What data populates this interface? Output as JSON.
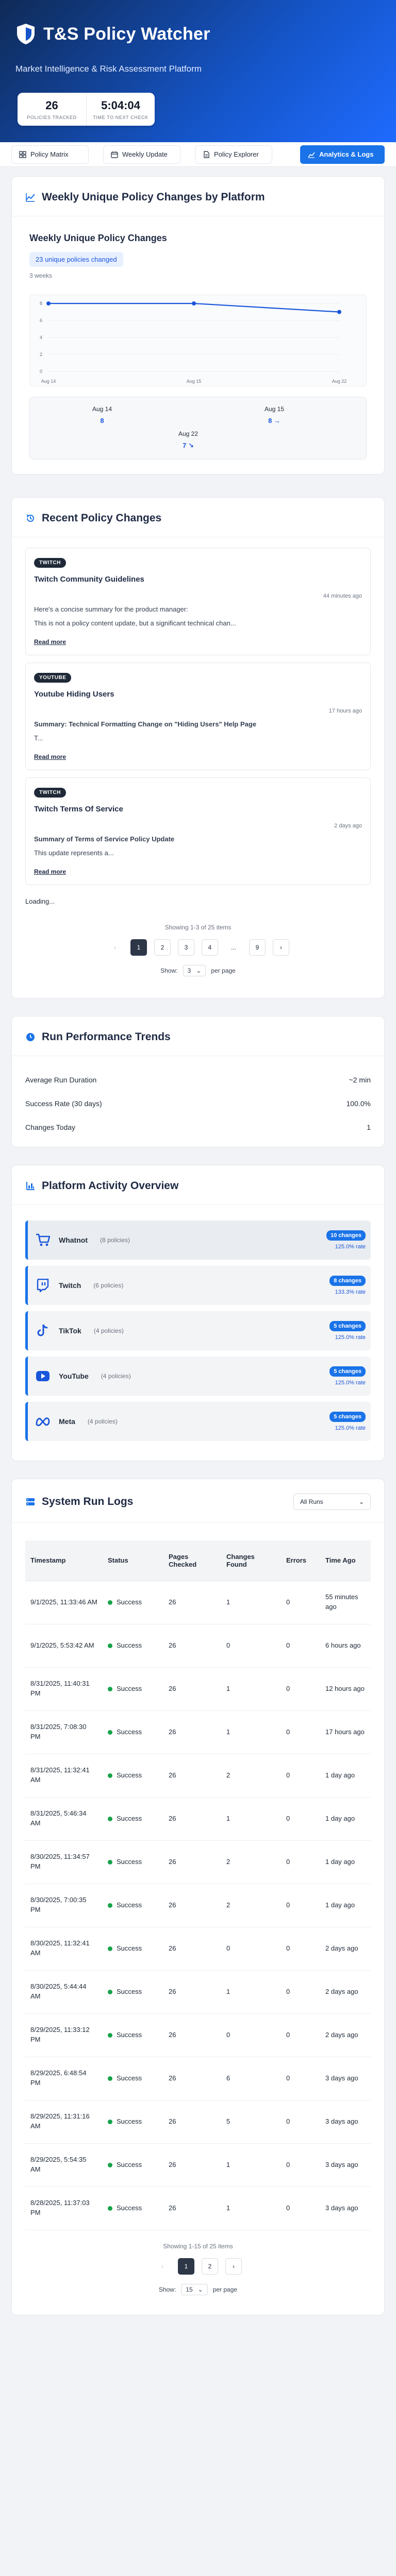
{
  "app": {
    "title": "T&S Policy Watcher",
    "subtitle": "Market Intelligence & Risk Assessment Platform",
    "stats": [
      {
        "value": "26",
        "label": "Policies Tracked"
      },
      {
        "value": "5:04:04",
        "label": "Time to next check"
      }
    ]
  },
  "nav": {
    "tabs": [
      {
        "label": "Policy Matrix",
        "icon": "grid-icon"
      },
      {
        "label": "Weekly Update",
        "icon": "calendar-icon"
      },
      {
        "label": "Policy Explorer",
        "icon": "document-icon"
      },
      {
        "label": "Analytics & Logs",
        "icon": "chart-icon",
        "active": true
      }
    ]
  },
  "weekly": {
    "card_title": "Weekly Unique Policy Changes by Platform",
    "chart_title": "Weekly Unique Policy Changes",
    "badge": "23 unique policies changed",
    "period": "3 weeks"
  },
  "chart_data": {
    "type": "line",
    "title": "Weekly Unique Policy Changes",
    "categories": [
      "Aug 14",
      "Aug 15",
      "Aug 22"
    ],
    "series": [
      {
        "values": [
          8,
          8,
          7
        ]
      }
    ],
    "ylim": [
      0,
      8
    ],
    "yticks": [
      0,
      2,
      4,
      6,
      8
    ],
    "grid": true,
    "color": "#1a56db"
  },
  "weekly_points": [
    {
      "date": "Aug 14",
      "value": "8"
    },
    {
      "date": "Aug 15",
      "value": "8 →"
    },
    {
      "date": "Aug 22",
      "value": "7 ↘"
    }
  ],
  "recent": {
    "card_title": "Recent Policy Changes",
    "items": [
      {
        "platform": "TWITCH",
        "title": "Twitch Community Guidelines",
        "time": "44 minutes ago",
        "line1": "Here's a concise summary for the product manager:",
        "line2": "This is not a policy content update, but a significant technical chan...",
        "line1_bold": false,
        "read_more": "Read more"
      },
      {
        "platform": "YOUTUBE",
        "title": "Youtube Hiding Users",
        "time": "17 hours ago",
        "line1": "Summary: Technical Formatting Change on \"Hiding Users\" Help Page",
        "line2": "T...",
        "line1_bold": true,
        "read_more": "Read more"
      },
      {
        "platform": "TWITCH",
        "title": "Twitch Terms Of Service",
        "time": "2 days ago",
        "line1": "Summary of Terms of Service Policy Update",
        "line2": "This update represents a...",
        "line1_bold": true,
        "read_more": "Read more"
      }
    ],
    "loading": "Loading...",
    "pager_info": "Showing 1-3 of 25 items",
    "pages": [
      "1",
      "2",
      "3",
      "4",
      "...",
      "9"
    ],
    "show_label": "Show:",
    "show_value": "3",
    "per_page": "per page"
  },
  "performance": {
    "card_title": "Run Performance Trends",
    "rows": [
      {
        "label": "Average Run Duration",
        "value": "~2 min"
      },
      {
        "label": "Success Rate (30 days)",
        "value": "100.0%"
      },
      {
        "label": "Changes Today",
        "value": "1"
      }
    ]
  },
  "platforms": {
    "card_title": "Platform Activity Overview",
    "items": [
      {
        "name": "Whatnot",
        "count": "(8 policies)",
        "badge": "10 changes",
        "rate": "125.0% rate",
        "icon": "cart-icon",
        "color": "#1f6bd6"
      },
      {
        "name": "Twitch",
        "count": "(6 policies)",
        "badge": "8 changes",
        "rate": "133.3% rate",
        "icon": "twitch-icon",
        "color": "#1f6bd6"
      },
      {
        "name": "TikTok",
        "count": "(4 policies)",
        "badge": "5 changes",
        "rate": "125.0% rate",
        "icon": "tiktok-icon",
        "color": "#1f6bd6"
      },
      {
        "name": "YouTube",
        "count": "(4 policies)",
        "badge": "5 changes",
        "rate": "125.0% rate",
        "icon": "youtube-icon",
        "color": "#1f6bd6"
      },
      {
        "name": "Meta",
        "count": "(4 policies)",
        "badge": "5 changes",
        "rate": "125.0% rate",
        "icon": "meta-icon",
        "color": "#1f6bd6"
      }
    ]
  },
  "logs": {
    "card_title": "System Run Logs",
    "filter": "All Runs",
    "columns": [
      "Timestamp",
      "Status",
      "Pages Checked",
      "Changes Found",
      "Errors",
      "Time Ago"
    ],
    "rows": [
      [
        "9/1/2025, 11:33:46 AM",
        "Success",
        "26",
        "1",
        "0",
        "55 minutes ago"
      ],
      [
        "9/1/2025, 5:53:42 AM",
        "Success",
        "26",
        "0",
        "0",
        "6 hours ago"
      ],
      [
        "8/31/2025, 11:40:31 PM",
        "Success",
        "26",
        "1",
        "0",
        "12 hours ago"
      ],
      [
        "8/31/2025, 7:08:30 PM",
        "Success",
        "26",
        "1",
        "0",
        "17 hours ago"
      ],
      [
        "8/31/2025, 11:32:41 AM",
        "Success",
        "26",
        "2",
        "0",
        "1 day ago"
      ],
      [
        "8/31/2025, 5:46:34 AM",
        "Success",
        "26",
        "1",
        "0",
        "1 day ago"
      ],
      [
        "8/30/2025, 11:34:57 PM",
        "Success",
        "26",
        "2",
        "0",
        "1 day ago"
      ],
      [
        "8/30/2025, 7:00:35 PM",
        "Success",
        "26",
        "2",
        "0",
        "1 day ago"
      ],
      [
        "8/30/2025, 11:32:41 AM",
        "Success",
        "26",
        "0",
        "0",
        "2 days ago"
      ],
      [
        "8/30/2025, 5:44:44 AM",
        "Success",
        "26",
        "1",
        "0",
        "2 days ago"
      ],
      [
        "8/29/2025, 11:33:12 PM",
        "Success",
        "26",
        "0",
        "0",
        "2 days ago"
      ],
      [
        "8/29/2025, 6:48:54 PM",
        "Success",
        "26",
        "6",
        "0",
        "3 days ago"
      ],
      [
        "8/29/2025, 11:31:16 AM",
        "Success",
        "26",
        "5",
        "0",
        "3 days ago"
      ],
      [
        "8/29/2025, 5:54:35 AM",
        "Success",
        "26",
        "1",
        "0",
        "3 days ago"
      ],
      [
        "8/28/2025, 11:37:03 PM",
        "Success",
        "26",
        "1",
        "0",
        "3 days ago"
      ]
    ],
    "pager_info": "Showing 1-15 of 25 items",
    "pages": [
      "1",
      "2"
    ],
    "show_label": "Show:",
    "show_value": "15",
    "per_page": "per page"
  }
}
